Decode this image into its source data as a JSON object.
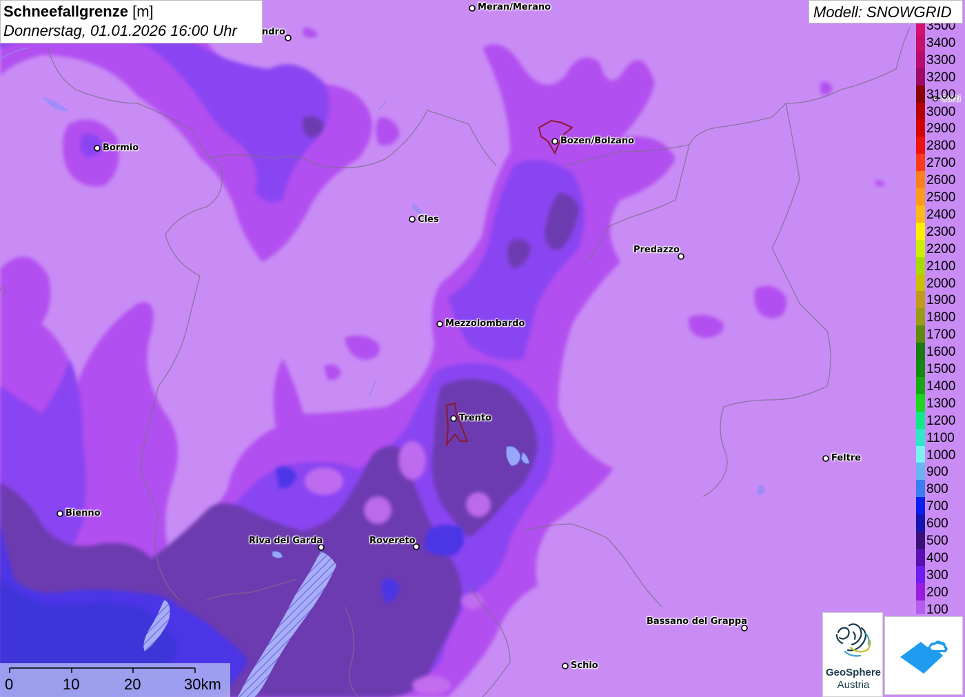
{
  "title": {
    "main_bold": "Schneefallgrenze",
    "main_unit": "[m]",
    "subtitle": "Donnerstag, 01.01.2026 16:00 Uhr"
  },
  "model_label": "Modell: SNOWGRID",
  "cities": [
    {
      "name": "Meran/Merano"
    },
    {
      "name": "ndro"
    },
    {
      "name": "Bormio"
    },
    {
      "name": "Bozen/Bolzano"
    },
    {
      "name": "Cles"
    },
    {
      "name": "Predazzo"
    },
    {
      "name": "Mezzolombardo"
    },
    {
      "name": "Trento"
    },
    {
      "name": "Feltre"
    },
    {
      "name": "Bienno"
    },
    {
      "name": "Riva del Garda"
    },
    {
      "name": "Rovereto"
    },
    {
      "name": "Bassano del Grappa"
    },
    {
      "name": "Schio"
    },
    {
      "name": "Corti"
    }
  ],
  "legend": {
    "items": [
      {
        "label": "3500",
        "color": "#d4116e"
      },
      {
        "label": "3400",
        "color": "#c8106a"
      },
      {
        "label": "3300",
        "color": "#b80c70"
      },
      {
        "label": "3200",
        "color": "#9e0a66"
      },
      {
        "label": "3100",
        "color": "#8a0000"
      },
      {
        "label": "3000",
        "color": "#b40000"
      },
      {
        "label": "2900",
        "color": "#d40000"
      },
      {
        "label": "2800",
        "color": "#ee1111"
      },
      {
        "label": "2700",
        "color": "#ff3a1a"
      },
      {
        "label": "2600",
        "color": "#ff7f1c"
      },
      {
        "label": "2500",
        "color": "#ff9a1a"
      },
      {
        "label": "2400",
        "color": "#ffb81a"
      },
      {
        "label": "2300",
        "color": "#ffee00"
      },
      {
        "label": "2200",
        "color": "#ccf000"
      },
      {
        "label": "2100",
        "color": "#aadb00"
      },
      {
        "label": "2000",
        "color": "#c6c000"
      },
      {
        "label": "1900",
        "color": "#c09a18"
      },
      {
        "label": "1800",
        "color": "#9a9a14"
      },
      {
        "label": "1700",
        "color": "#5f8a10"
      },
      {
        "label": "1600",
        "color": "#1a7a10"
      },
      {
        "label": "1500",
        "color": "#108a10"
      },
      {
        "label": "1400",
        "color": "#16a816"
      },
      {
        "label": "1300",
        "color": "#1ed61e"
      },
      {
        "label": "1200",
        "color": "#12e88a"
      },
      {
        "label": "1100",
        "color": "#2ee8c8"
      },
      {
        "label": "1000",
        "color": "#7af2f2"
      },
      {
        "label": "900",
        "color": "#6ab4f4"
      },
      {
        "label": "800",
        "color": "#3a7ef0"
      },
      {
        "label": "700",
        "color": "#0a1ef0"
      },
      {
        "label": "600",
        "color": "#1414b0"
      },
      {
        "label": "500",
        "color": "#3a0f7a"
      },
      {
        "label": "400",
        "color": "#5a0fb4"
      },
      {
        "label": "300",
        "color": "#6e1cf0"
      },
      {
        "label": "200",
        "color": "#9a1cdc"
      },
      {
        "label": "100",
        "color": "#b45ef0"
      }
    ]
  },
  "scalebar": {
    "ticks": [
      "0",
      "10",
      "20",
      "30km"
    ]
  },
  "logo": {
    "name": "GeoSphere",
    "sub": "Austria"
  },
  "colors": {
    "base_pink": "#c98cf5",
    "magenta": "#b14cf0",
    "violet": "#8a3cf0",
    "dark_violet": "#6a3aa8",
    "blue": "#4a2ee0",
    "lake": "#9aa4f8"
  }
}
